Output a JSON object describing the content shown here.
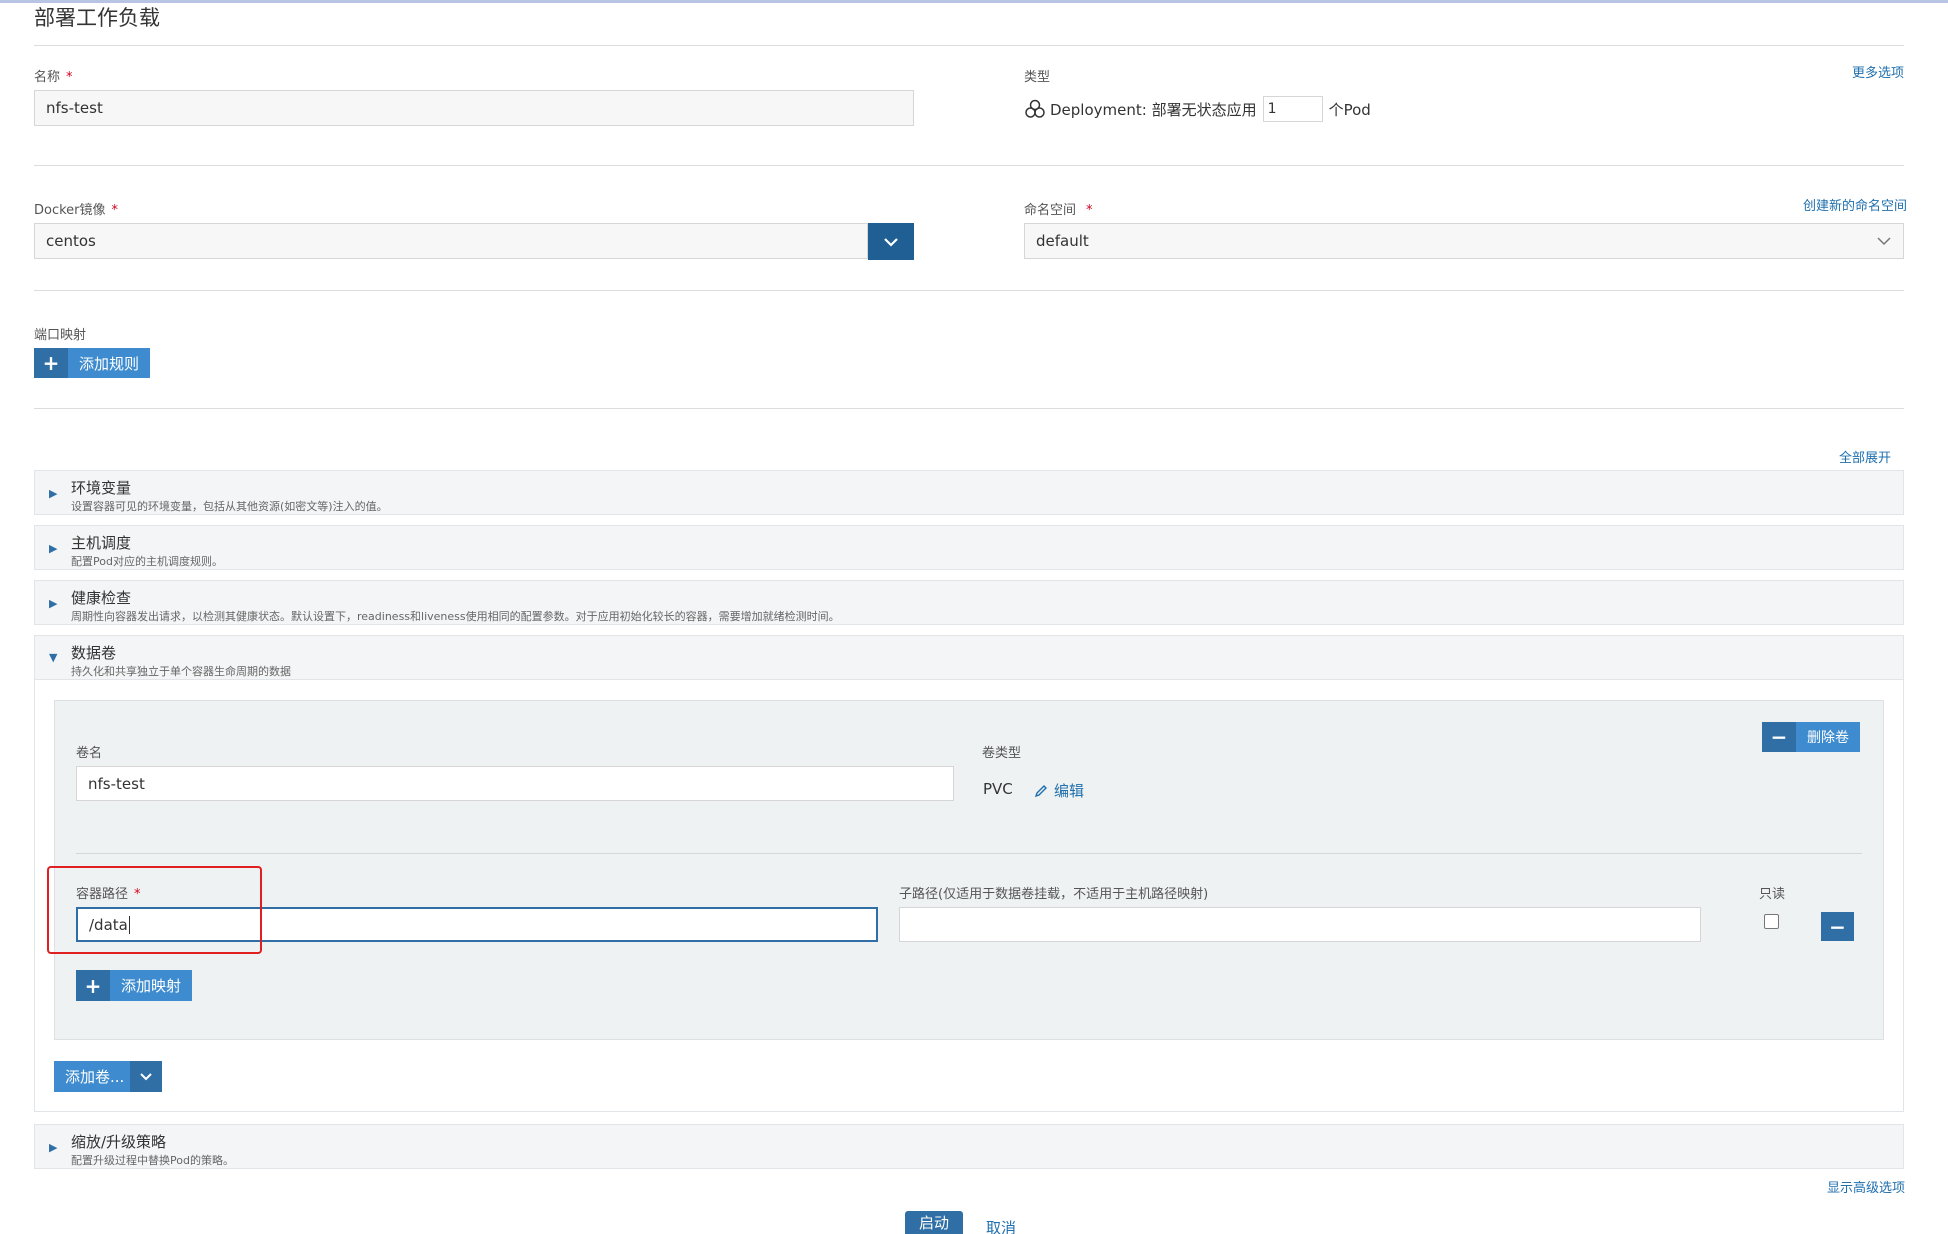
{
  "page": {
    "title": "部署工作负载"
  },
  "form": {
    "name": {
      "label": "名称",
      "required_mark": "*",
      "value": "nfs-test"
    },
    "type": {
      "label": "类型",
      "more_options": "更多选项",
      "icon": "deployment-icon",
      "prefix": "Deployment: 部署无状态应用",
      "replicas": "1",
      "suffix": "个Pod"
    },
    "docker_image": {
      "label": "Docker镜像",
      "required_mark": "*",
      "value": "centos"
    },
    "namespace": {
      "label": "命名空间",
      "required_mark": "*",
      "create_link": "创建新的命名空间",
      "value": "default"
    },
    "port_mapping": {
      "label": "端口映射",
      "add_rule": "添加规则"
    }
  },
  "expand_all": "全部展开",
  "sections": [
    {
      "title": "环境变量",
      "desc": "设置容器可见的环境变量，包括从其他资源(如密文等)注入的值。"
    },
    {
      "title": "主机调度",
      "desc": "配置Pod对应的主机调度规则。"
    },
    {
      "title": "健康检查",
      "desc": "周期性向容器发出请求，以检测其健康状态。默认设置下，readiness和liveness使用相同的配置参数。对于应用初始化较长的容器，需要增加就绪检测时间。"
    },
    {
      "title": "数据卷",
      "desc": "持久化和共享独立于单个容器生命周期的数据"
    },
    {
      "title": "缩放/升级策略",
      "desc": "配置升级过程中替换Pod的策略。"
    }
  ],
  "volume": {
    "name_label": "卷名",
    "name_value": "nfs-test",
    "type_label": "卷类型",
    "type_value": "PVC",
    "edit_label": "编辑",
    "remove_label": "删除卷",
    "mount": {
      "container_path_label": "容器路径",
      "required_mark": "*",
      "container_path_value": "/data",
      "sub_path_label": "子路径(仅适用于数据卷挂载，不适用于主机路径映射)",
      "sub_path_value": "",
      "readonly_label": "只读"
    },
    "add_mapping": "添加映射",
    "add_volume": "添加卷..."
  },
  "show_advanced": "显示高级选项",
  "actions": {
    "launch": "启动",
    "cancel": "取消"
  }
}
